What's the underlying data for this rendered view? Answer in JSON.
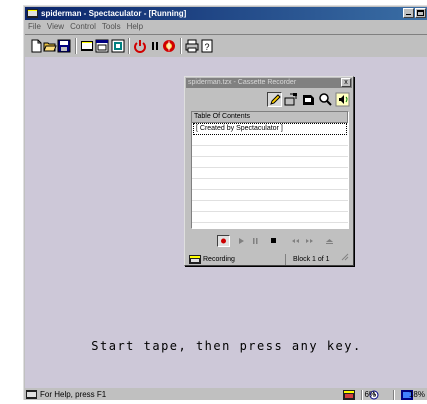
{
  "window": {
    "title": "spiderman - Spectaculator - [Running]",
    "controls": [
      "minimize",
      "maximize"
    ]
  },
  "menu": [
    "File",
    "View",
    "Control",
    "Tools",
    "Help"
  ],
  "toolbar": {
    "icons": [
      "new-icon",
      "open-icon",
      "save-icon",
      "fullscreen-icon",
      "window-icon",
      "screenshot-icon",
      "power-icon",
      "pause-icon",
      "tape-icon",
      "print-icon",
      "help-icon"
    ]
  },
  "emulator": {
    "message": "Start tape, then press any key."
  },
  "statusbar": {
    "help": "For Help, press F1",
    "speed": "6%",
    "cpu": "18%"
  },
  "recorder": {
    "title": "spiderman.tzx - Cassette Recorder",
    "close": "x",
    "toc_header": "Table Of Contents",
    "toc_rows": [
      "[ Created by Spectaculator ]"
    ],
    "status": "Recording",
    "block": "Block 1 of 1"
  },
  "colors": {
    "titlebar": "#0a246a",
    "emulator_bg": "#cdc8d8",
    "record": "#cc0000"
  }
}
